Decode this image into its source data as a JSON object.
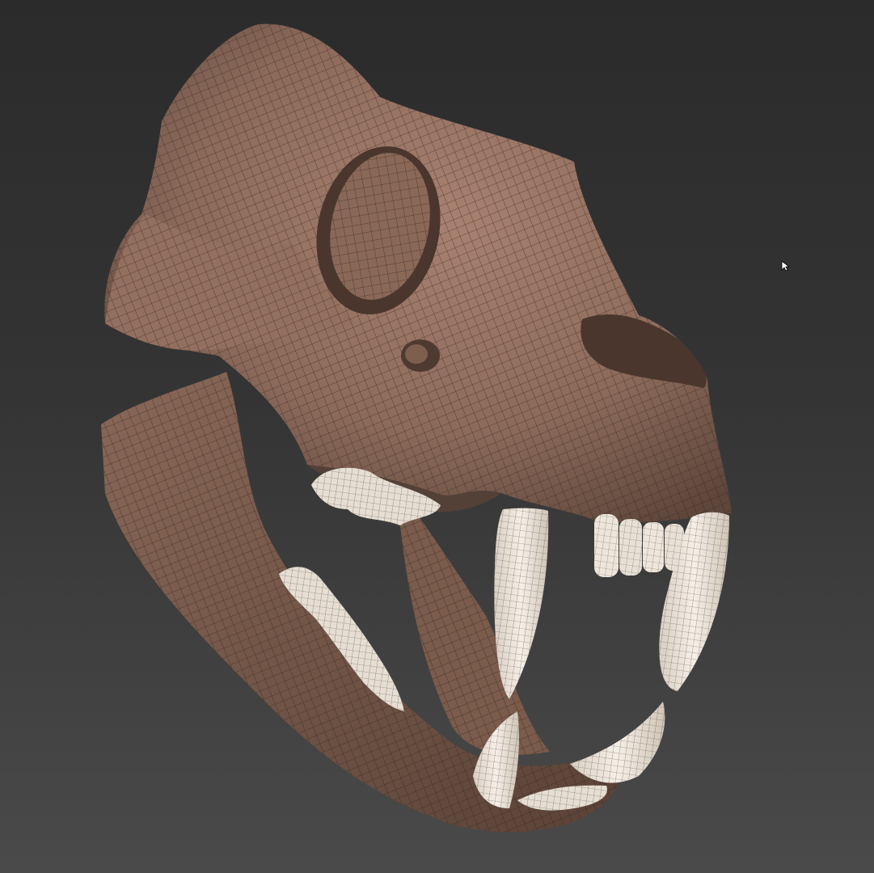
{
  "viewport": {
    "background_top": "#2b2b2b",
    "background_bottom": "#4a4a4a"
  },
  "model": {
    "subject": "skull-model",
    "display_mode": "wireframe-on-shaded",
    "bone_color": "#8c6a5b",
    "bone_shadow_color": "#4f3a31",
    "teeth_color": "#efe7dc",
    "wire_color": "#2a1f1a"
  },
  "cursor": {
    "icon": "arrow-pointer-icon"
  }
}
